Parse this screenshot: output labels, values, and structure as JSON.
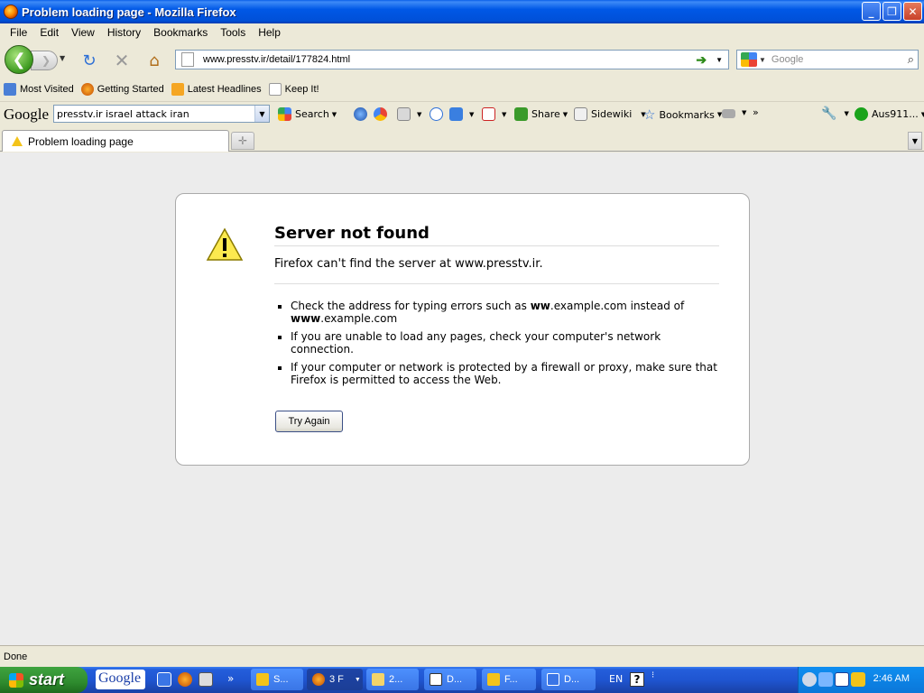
{
  "window": {
    "title": "Problem loading page - Mozilla Firefox"
  },
  "menu": {
    "items": [
      "File",
      "Edit",
      "View",
      "History",
      "Bookmarks",
      "Tools",
      "Help"
    ]
  },
  "navbar": {
    "url": "www.presstv.ir/detail/177824.html",
    "search_placeholder": "Google"
  },
  "bookmarks": {
    "items": [
      "Most Visited",
      "Getting Started",
      "Latest Headlines",
      "Keep It!"
    ]
  },
  "google_toolbar": {
    "logo": "Google",
    "query": "presstv.ir israel attack iran",
    "search_label": "Search",
    "share_label": "Share",
    "sidewiki_label": "Sidewiki",
    "bookmarks_label": "Bookmarks",
    "more": "»",
    "account": "Aus911..."
  },
  "tabs": {
    "active_label": "Problem loading page"
  },
  "error": {
    "title": "Server not found",
    "short_desc": "Firefox can't find the server at www.presstv.ir.",
    "bullet1_pre": "Check the address for typing errors such as ",
    "bullet1_b1": "ww",
    "bullet1_mid": ".example.com instead of ",
    "bullet1_b2": "www",
    "bullet1_post": ".example.com",
    "bullet2": "If you are unable to load any pages, check your computer's network connection.",
    "bullet3": "If your computer or network is protected by a firewall or proxy, make sure that Firefox is permitted to access the Web.",
    "try_again": "Try Again"
  },
  "status": {
    "text": "Done"
  },
  "taskbar": {
    "start": "start",
    "google": "Google",
    "tasks": [
      "S...",
      "3 F",
      "2...",
      "D...",
      "F...",
      "D..."
    ],
    "lang": "EN",
    "clock": "2:46 AM"
  },
  "colors": {
    "titlebar": "#0058e6",
    "taskbar": "#245edb",
    "start": "#2e8b2e",
    "content_bg": "#ececec"
  }
}
